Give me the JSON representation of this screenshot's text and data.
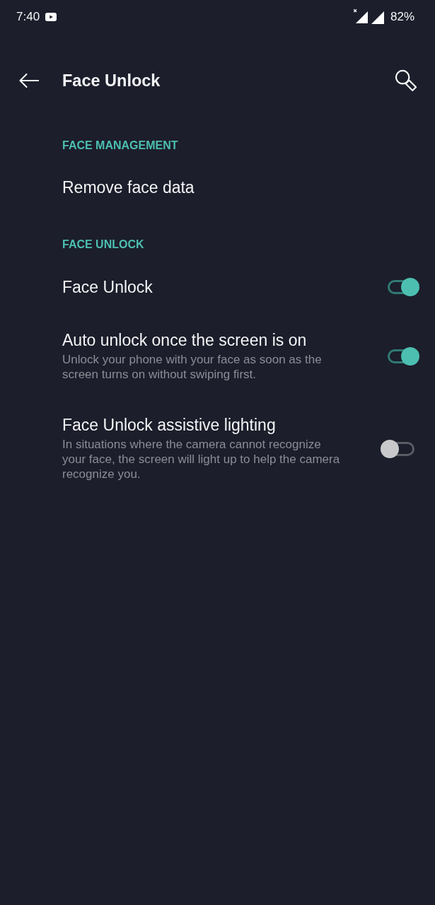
{
  "status_bar": {
    "time": "7:40",
    "battery": "82%"
  },
  "app_bar": {
    "title": "Face Unlock"
  },
  "sections": [
    {
      "header": "FACE MANAGEMENT",
      "items": [
        {
          "kind": "action",
          "title": "Remove face data"
        }
      ]
    },
    {
      "header": "FACE UNLOCK",
      "items": [
        {
          "kind": "switch",
          "title": "Face Unlock",
          "on": true
        },
        {
          "kind": "switch",
          "title": "Auto unlock once the screen is on",
          "summary": "Unlock your phone with your face as soon as the screen turns on without swiping first.",
          "on": true
        },
        {
          "kind": "switch",
          "title": "Face Unlock assistive lighting",
          "summary": "In situations where the camera cannot recognize your face, the screen will light up to help the camera recognize you.",
          "on": false
        }
      ]
    }
  ]
}
